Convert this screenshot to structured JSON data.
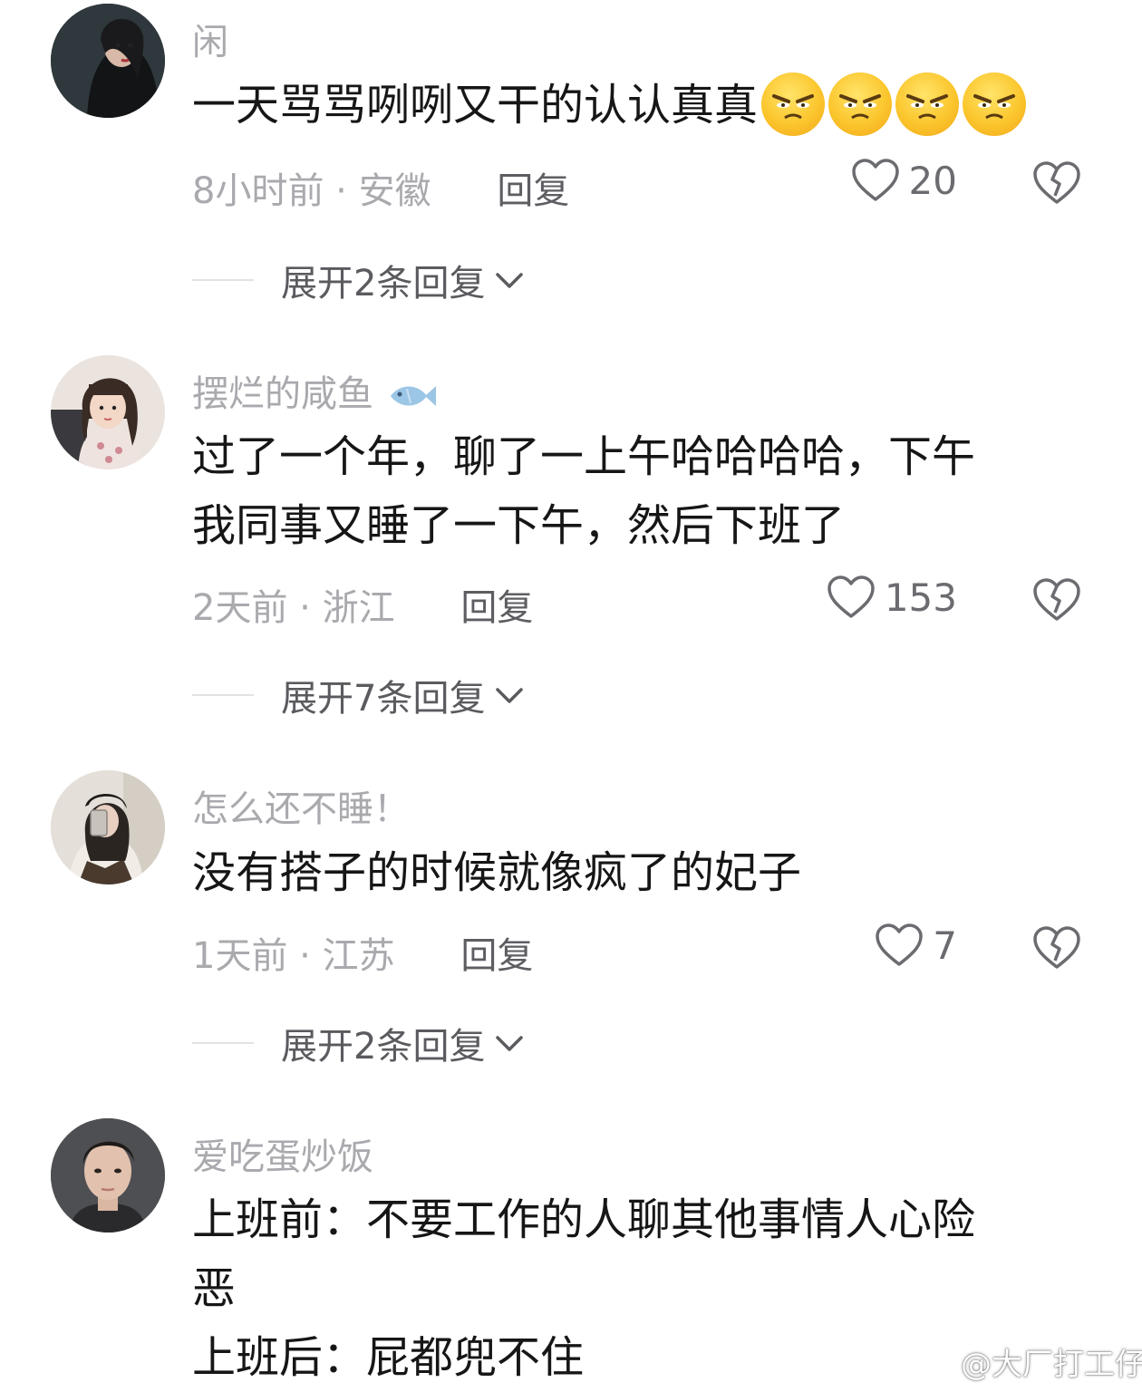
{
  "comments": [
    {
      "username": "闲",
      "text": "一天骂骂咧咧又干的认认真真",
      "emoji_icon": "angry-face-emoji",
      "time": "8小时前",
      "location": "安徽",
      "reply_label": "回复",
      "likes": "20",
      "expand_label": "展开2条回复"
    },
    {
      "username": "摆烂的咸鱼",
      "text_lines": [
        "过了一个年，聊了一上午哈哈哈哈，下午",
        "我同事又睡了一下午，然后下班了"
      ],
      "time": "2天前",
      "location": "浙江",
      "reply_label": "回复",
      "likes": "153",
      "expand_label": "展开7条回复"
    },
    {
      "username": "怎么还不睡！",
      "text": "没有搭子的时候就像疯了的妃子",
      "time": "1天前",
      "location": "江苏",
      "reply_label": "回复",
      "likes": "7",
      "expand_label": "展开2条回复"
    },
    {
      "username": "爱吃蛋炒饭",
      "text_lines": [
        "上班前：不要工作的人聊其他事情人心险",
        "恶",
        "上班后：屁都兜不住"
      ]
    }
  ],
  "separator": "·",
  "watermark": "@大厂打工仔",
  "colors": {
    "meta": "#a9a9ae",
    "text": "#161616",
    "emoji": "#fbc62d"
  }
}
